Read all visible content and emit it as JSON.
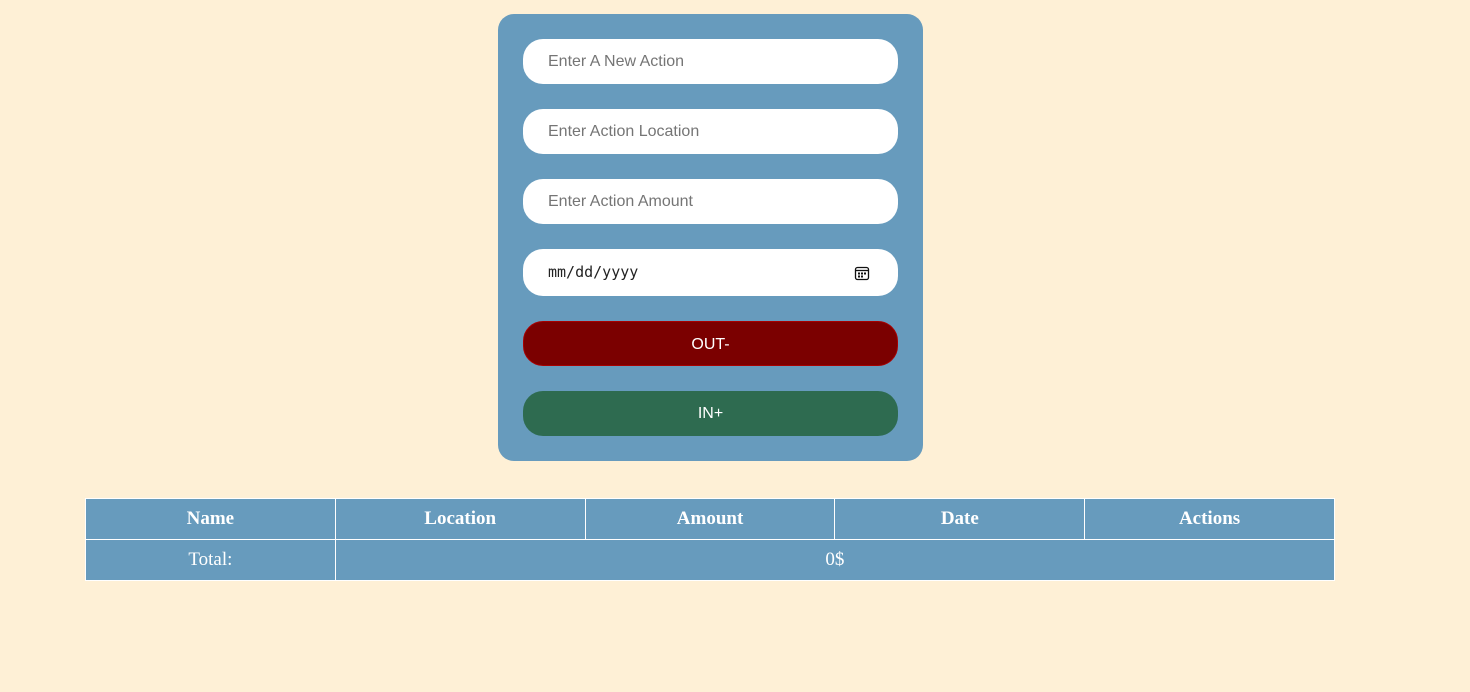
{
  "form": {
    "action_name_placeholder": "Enter A New Action",
    "location_placeholder": "Enter Action Location",
    "amount_placeholder": "Enter Action Amount",
    "date_placeholder": "mm/dd/yyyy",
    "out_button_label": "OUT-",
    "in_button_label": "IN+"
  },
  "table": {
    "headers": [
      "Name",
      "Location",
      "Amount",
      "Date",
      "Actions"
    ],
    "total_label": "Total:",
    "total_value": "0$"
  },
  "colors": {
    "page_background": "#fef0d6",
    "panel": "#679bbd",
    "out_button": "#7b0000",
    "in_button": "#2e6b50"
  },
  "icons": {
    "date_picker": "calendar-icon"
  }
}
